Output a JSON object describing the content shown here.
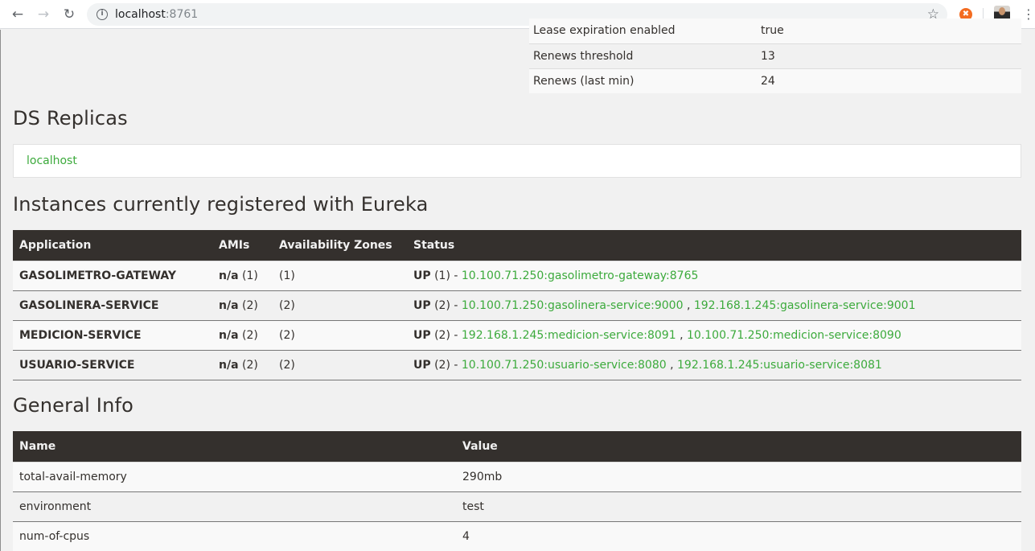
{
  "browser": {
    "url_host": "localhost",
    "url_port": ":8761"
  },
  "stats": {
    "rows": [
      {
        "label": "Lease expiration enabled",
        "value": "true"
      },
      {
        "label": "Renews threshold",
        "value": "13"
      },
      {
        "label": "Renews (last min)",
        "value": "24"
      }
    ]
  },
  "replicas": {
    "title": "DS Replicas",
    "link": "localhost"
  },
  "instances": {
    "title": "Instances currently registered with Eureka",
    "headers": [
      "Application",
      "AMIs",
      "Availability Zones",
      "Status"
    ],
    "rows": [
      {
        "app": "GASOLIMETRO-GATEWAY",
        "ami_bold": "n/a",
        "ami_count": " (1)",
        "zones": "(1)",
        "status_up": "UP",
        "status_count": " (1) - ",
        "link1": "10.100.71.250:gasolimetro-gateway:8765",
        "sep": "",
        "link2": ""
      },
      {
        "app": "GASOLINERA-SERVICE",
        "ami_bold": "n/a",
        "ami_count": " (2)",
        "zones": "(2)",
        "status_up": "UP",
        "status_count": " (2) - ",
        "link1": "10.100.71.250:gasolinera-service:9000",
        "sep": " , ",
        "link2": "192.168.1.245:gasolinera-service:9001"
      },
      {
        "app": "MEDICION-SERVICE",
        "ami_bold": "n/a",
        "ami_count": " (2)",
        "zones": "(2)",
        "status_up": "UP",
        "status_count": " (2) - ",
        "link1": "192.168.1.245:medicion-service:8091",
        "sep": " , ",
        "link2": "10.100.71.250:medicion-service:8090"
      },
      {
        "app": "USUARIO-SERVICE",
        "ami_bold": "n/a",
        "ami_count": " (2)",
        "zones": "(2)",
        "status_up": "UP",
        "status_count": " (2) - ",
        "link1": "10.100.71.250:usuario-service:8080",
        "sep": " , ",
        "link2": "192.168.1.245:usuario-service:8081"
      }
    ]
  },
  "general": {
    "title": "General Info",
    "headers": [
      "Name",
      "Value"
    ],
    "rows": [
      {
        "name": "total-avail-memory",
        "value": "290mb"
      },
      {
        "name": "environment",
        "value": "test"
      },
      {
        "name": "num-of-cpus",
        "value": "4"
      }
    ]
  }
}
